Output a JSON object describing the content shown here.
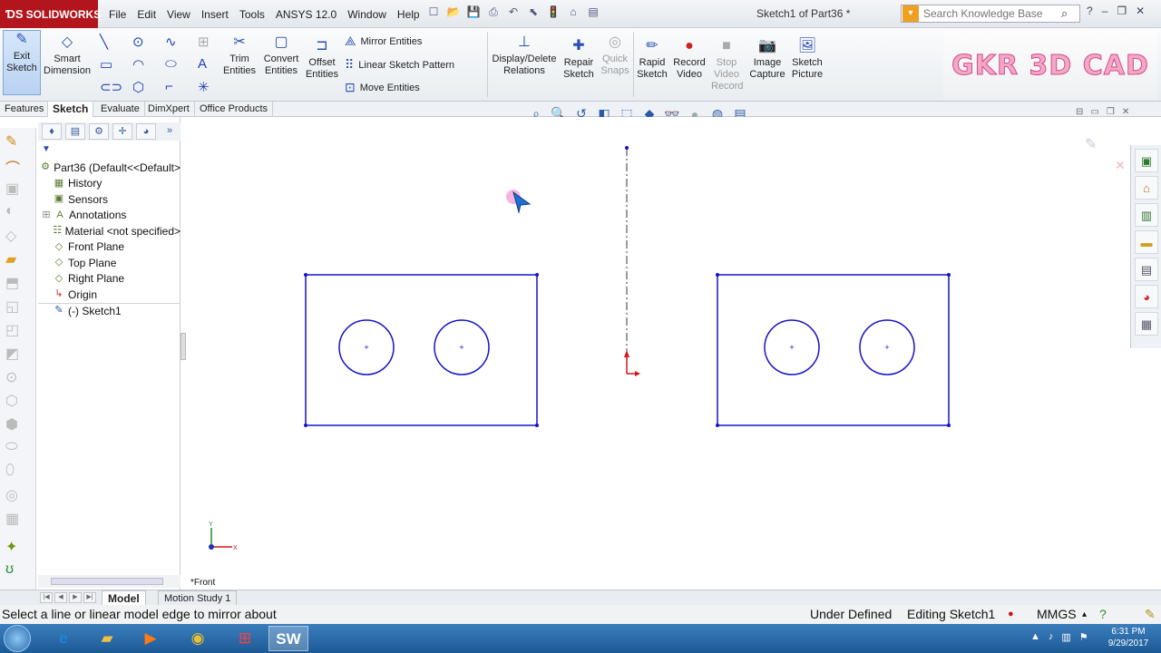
{
  "app": {
    "brand": "SOLIDWORKS",
    "doc_title": "Sketch1 of Part36 *"
  },
  "menu": [
    "File",
    "Edit",
    "View",
    "Insert",
    "Tools",
    "ANSYS 12.0",
    "Window",
    "Help"
  ],
  "search": {
    "placeholder": "Search Knowledge Base"
  },
  "ribbon": {
    "exit_sketch": "Exit Sketch",
    "smart_dimension": "Smart Dimension",
    "trim": "Trim Entities",
    "convert": "Convert Entities",
    "offset": "Offset Entities",
    "mirror": "Mirror Entities",
    "linear_pattern": "Linear Sketch Pattern",
    "move": "Move Entities",
    "display_delete": "Display/Delete Relations",
    "repair": "Repair Sketch",
    "quick_snaps": "Quick Snaps",
    "rapid_sketch": "Rapid Sketch",
    "record_video": "Record Video",
    "stop_video": "Stop Video Record",
    "image_capture": "Image Capture",
    "sketch_picture": "Sketch Picture"
  },
  "watermark": "GKR 3D CAD",
  "tabs": [
    "Features",
    "Sketch",
    "Evaluate",
    "DimXpert",
    "Office Products"
  ],
  "active_tab": "Sketch",
  "tree": {
    "root": "Part36  (Default<<Default>",
    "items": [
      "History",
      "Sensors",
      "Annotations",
      "Material <not specified>",
      "Front Plane",
      "Top Plane",
      "Right Plane",
      "Origin",
      "(-) Sketch1"
    ]
  },
  "canvas": {
    "view_label": "*Front"
  },
  "bottom_tabs": [
    "Model",
    "Motion Study 1"
  ],
  "status": {
    "message": "Select a line or linear model edge to mirror about",
    "defined": "Under Defined",
    "editing": "Editing Sketch1",
    "units": "MMGS"
  },
  "clock": {
    "time": "6:31 PM",
    "date": "9/29/2017"
  },
  "colors": {
    "sketch_blue": "#1414c8",
    "brand_red": "#b2151c"
  }
}
